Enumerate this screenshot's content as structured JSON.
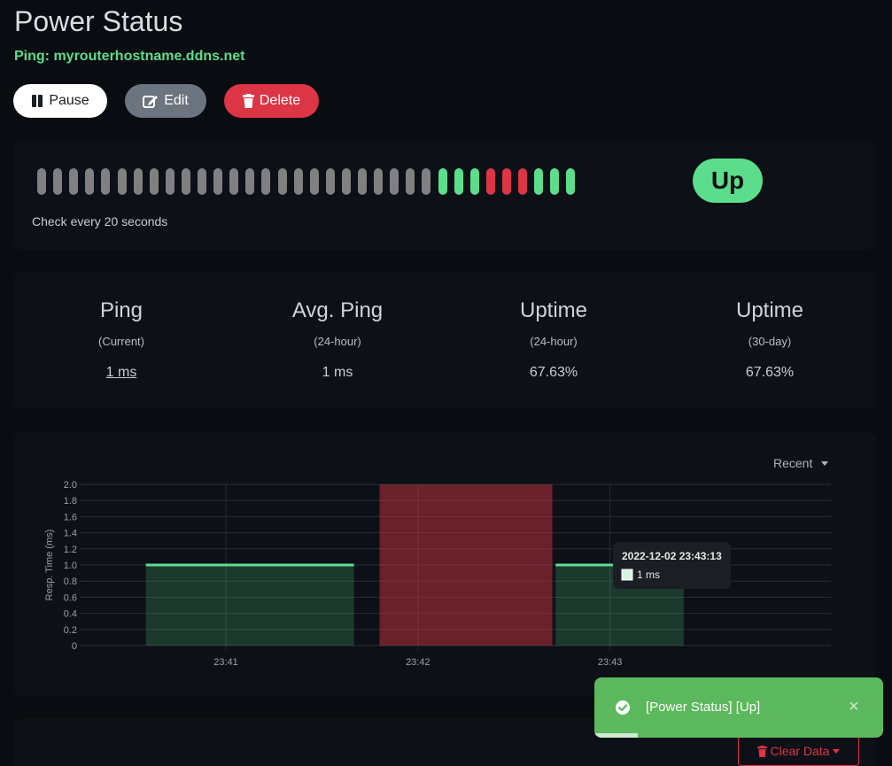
{
  "monitor": {
    "title": "Power Status",
    "ping_target": "Ping: myrouterhostname.ddns.net"
  },
  "actions": {
    "pause_label": "Pause",
    "edit_label": "Edit",
    "delete_label": "Delete"
  },
  "heartbeat": {
    "beats": [
      "empty",
      "empty",
      "empty",
      "empty",
      "empty",
      "empty",
      "empty",
      "empty",
      "empty",
      "empty",
      "empty",
      "empty",
      "empty",
      "empty",
      "empty",
      "empty",
      "empty",
      "empty",
      "empty",
      "empty",
      "empty",
      "empty",
      "empty",
      "empty",
      "empty",
      "up",
      "up",
      "up",
      "down",
      "down",
      "down",
      "up",
      "up",
      "up"
    ],
    "check_interval_text": "Check every 20 seconds",
    "status": "Up",
    "colors": {
      "up": "#5cdd8b",
      "down": "#dc3545",
      "empty": "#808080"
    }
  },
  "stats": [
    {
      "title": "Ping",
      "subtitle": "(Current)",
      "value": "1 ms"
    },
    {
      "title": "Avg. Ping",
      "subtitle": "(24-hour)",
      "value": "1 ms"
    },
    {
      "title": "Uptime",
      "subtitle": "(24-hour)",
      "value": "67.63%"
    },
    {
      "title": "Uptime",
      "subtitle": "(30-day)",
      "value": "67.63%"
    }
  ],
  "chart": {
    "range_label": "Recent",
    "tooltip": {
      "title": "2022-12-02 23:43:13",
      "value": "1 ms"
    }
  },
  "chart_data": {
    "type": "area",
    "title": "",
    "xlabel": "",
    "ylabel": "Resp. Time (ms)",
    "ylim": [
      0,
      2.0
    ],
    "yticks": [
      "0",
      "0.2",
      "0.4",
      "0.6",
      "0.8",
      "1.0",
      "1.2",
      "1.4",
      "1.6",
      "1.8",
      "2.0"
    ],
    "xticks": [
      "23:41",
      "23:42",
      "23:43"
    ],
    "grid": true,
    "series": [
      {
        "values": [
          {
            "start": "23:40:35",
            "end": "23:41:40",
            "value": 1.0
          },
          {
            "start": "23:42:43",
            "end": "23:43:23",
            "value": 1.0
          }
        ]
      }
    ],
    "down_periods": [
      {
        "start": "23:41:48",
        "end": "23:42:42"
      }
    ],
    "colors": {
      "line": "#5cdd8b",
      "fill": "rgba(92,221,139,0.2)",
      "down": "rgba(220,53,69,0.45)"
    }
  },
  "bottom": {
    "clear_data_label": "Clear Data"
  },
  "toast": {
    "message": "[Power Status] [Up]",
    "close_glyph": "×",
    "progress": 0.15
  }
}
